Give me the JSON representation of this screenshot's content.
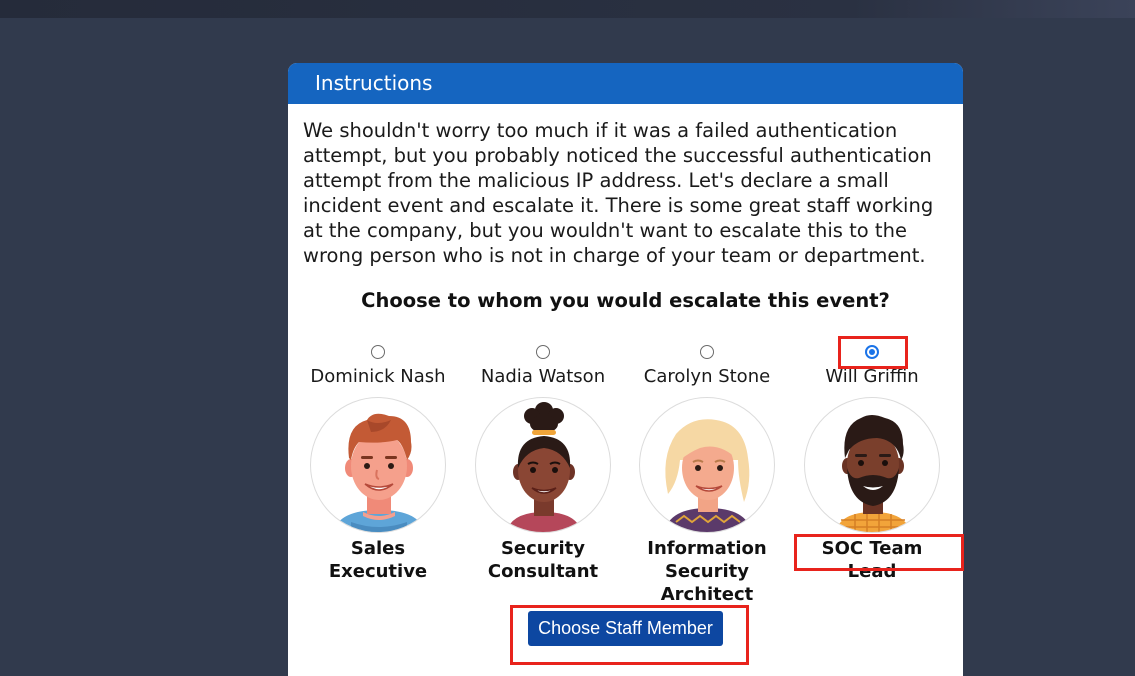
{
  "modal": {
    "title": "Instructions",
    "instructions": "We shouldn't worry too much if it was a failed authentication attempt, but you probably noticed the successful authentication attempt from the malicious IP address. Let's declare a small incident event and escalate it. There is some great staff working at the company, but you wouldn't want to escalate this to the wrong person who is not in charge of your team or department.",
    "question": "Choose to whom you would escalate this event?"
  },
  "staff": [
    {
      "name": "Dominick Nash",
      "role": "Sales Executive",
      "selected": false,
      "avatar": "man-brown-hair-avatar"
    },
    {
      "name": "Nadia Watson",
      "role": "Security Consultant",
      "selected": false,
      "avatar": "woman-hair-bun-avatar"
    },
    {
      "name": "Carolyn Stone",
      "role": "Information Security Architect",
      "selected": false,
      "avatar": "woman-blonde-avatar"
    },
    {
      "name": "Will Griffin",
      "role": "SOC Team Lead",
      "selected": true,
      "avatar": "man-beard-avatar"
    }
  ],
  "actions": {
    "choose_label": "Choose Staff Member"
  },
  "colors": {
    "header": "#1565c0",
    "button": "#0d47a1",
    "highlight": "#e8231c",
    "background": "#313a4d"
  }
}
